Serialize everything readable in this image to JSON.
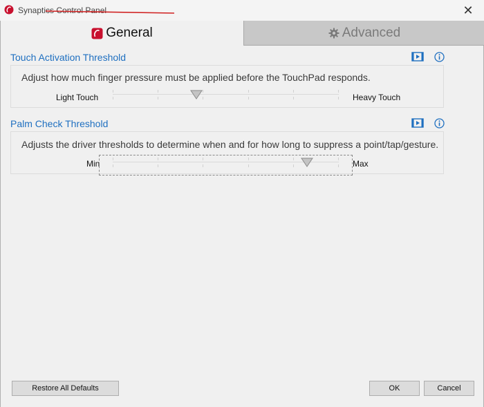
{
  "window": {
    "title": "Synaptics Control Panel",
    "close_glyph": "✕"
  },
  "tabs": [
    {
      "label": "General",
      "icon": "synaptics-logo-icon",
      "active": true
    },
    {
      "label": "Advanced",
      "icon": "gear-icon",
      "active": false
    }
  ],
  "touch_threshold": {
    "title": "Touch Activation Threshold",
    "description": "Adjust how much finger pressure must be applied before the TouchPad responds.",
    "min_label": "Light Touch",
    "max_label": "Heavy Touch",
    "value_fraction": 0.37
  },
  "palm_check": {
    "title": "Palm Check Threshold",
    "description": "Adjusts the driver thresholds to determine when and for how long to suppress a point/tap/gesture.",
    "min_label": "Min",
    "max_label": "Max",
    "value_fraction": 0.86
  },
  "buttons": {
    "restore_defaults": "Restore All Defaults",
    "ok": "OK",
    "cancel": "Cancel"
  },
  "colors": {
    "accent": "#1e6fc0",
    "brand_red": "#c8102e"
  }
}
